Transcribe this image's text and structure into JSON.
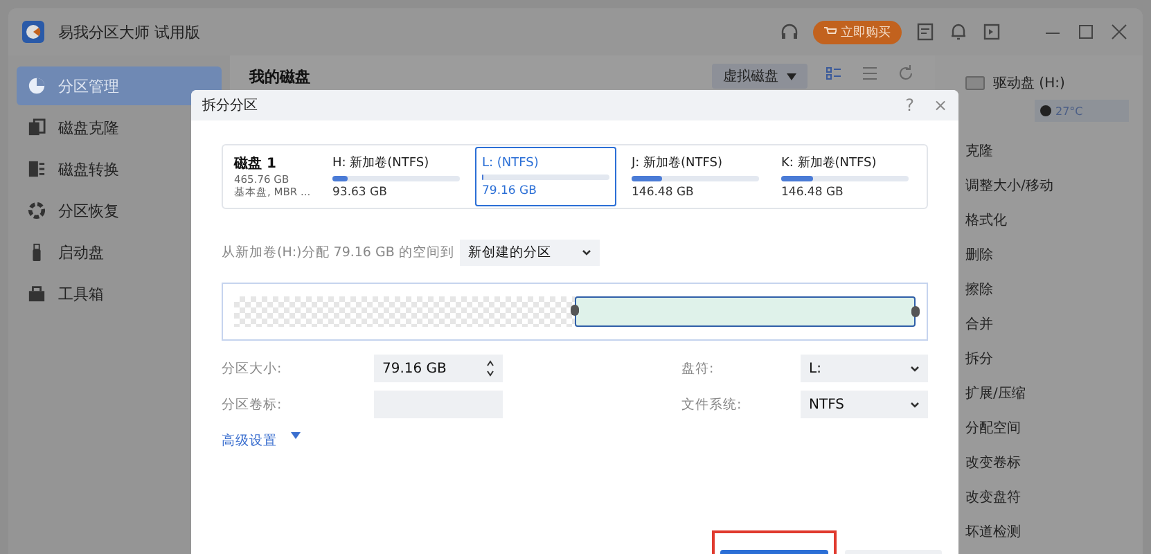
{
  "window": {
    "title": "易我分区大师 试用版",
    "buy_button": "立即购买"
  },
  "sidebar": {
    "items": [
      {
        "label": "分区管理",
        "selected": true
      },
      {
        "label": "磁盘克隆",
        "selected": false
      },
      {
        "label": "磁盘转换",
        "selected": false
      },
      {
        "label": "分区恢复",
        "selected": false
      },
      {
        "label": "启动盘",
        "selected": false
      },
      {
        "label": "工具箱",
        "selected": false
      }
    ]
  },
  "main": {
    "title": "我的磁盘",
    "virtual_disk": "虚拟磁盘"
  },
  "right_panel": {
    "drive": "驱动盘 (H:)",
    "temperature": "27°C",
    "actions": [
      "克隆",
      "调整大小/移动",
      "格式化",
      "删除",
      "擦除",
      "合并",
      "拆分",
      "扩展/压缩",
      "分配空间",
      "改变卷标",
      "改变盘符",
      "坏道检测"
    ]
  },
  "dialog": {
    "title": "拆分分区",
    "help": "?",
    "close": "×",
    "disk": {
      "name": "磁盘 1",
      "size": "465.76 GB",
      "type": "基本盘, MBR ..."
    },
    "partitions": [
      {
        "label": "H: 新加卷(NTFS)",
        "size": "93.63 GB",
        "level": 0.12,
        "selected": false
      },
      {
        "label": "L: (NTFS)",
        "size": "79.16 GB",
        "level": 0.01,
        "selected": true
      },
      {
        "label": "J: 新加卷(NTFS)",
        "size": "146.48 GB",
        "level": 0.24,
        "selected": false
      },
      {
        "label": "K: 新加卷(NTFS)",
        "size": "146.48 GB",
        "level": 0.25,
        "selected": false
      }
    ],
    "allocate_label": "从新加卷(H:)分配 79.16 GB 的空间到",
    "allocate_target": "新创建的分区",
    "split": {
      "level": 0.5
    },
    "fields": [
      {
        "label": "分区大小:",
        "value": "79.16 GB",
        "kind": "spinner"
      },
      {
        "label": "盘符:",
        "value": "L:",
        "kind": "select"
      },
      {
        "label": "分区卷标:",
        "kind": "text"
      },
      {
        "label": "文件系统:",
        "value": "NTFS",
        "kind": "select"
      }
    ],
    "advanced": "高级设置"
  }
}
